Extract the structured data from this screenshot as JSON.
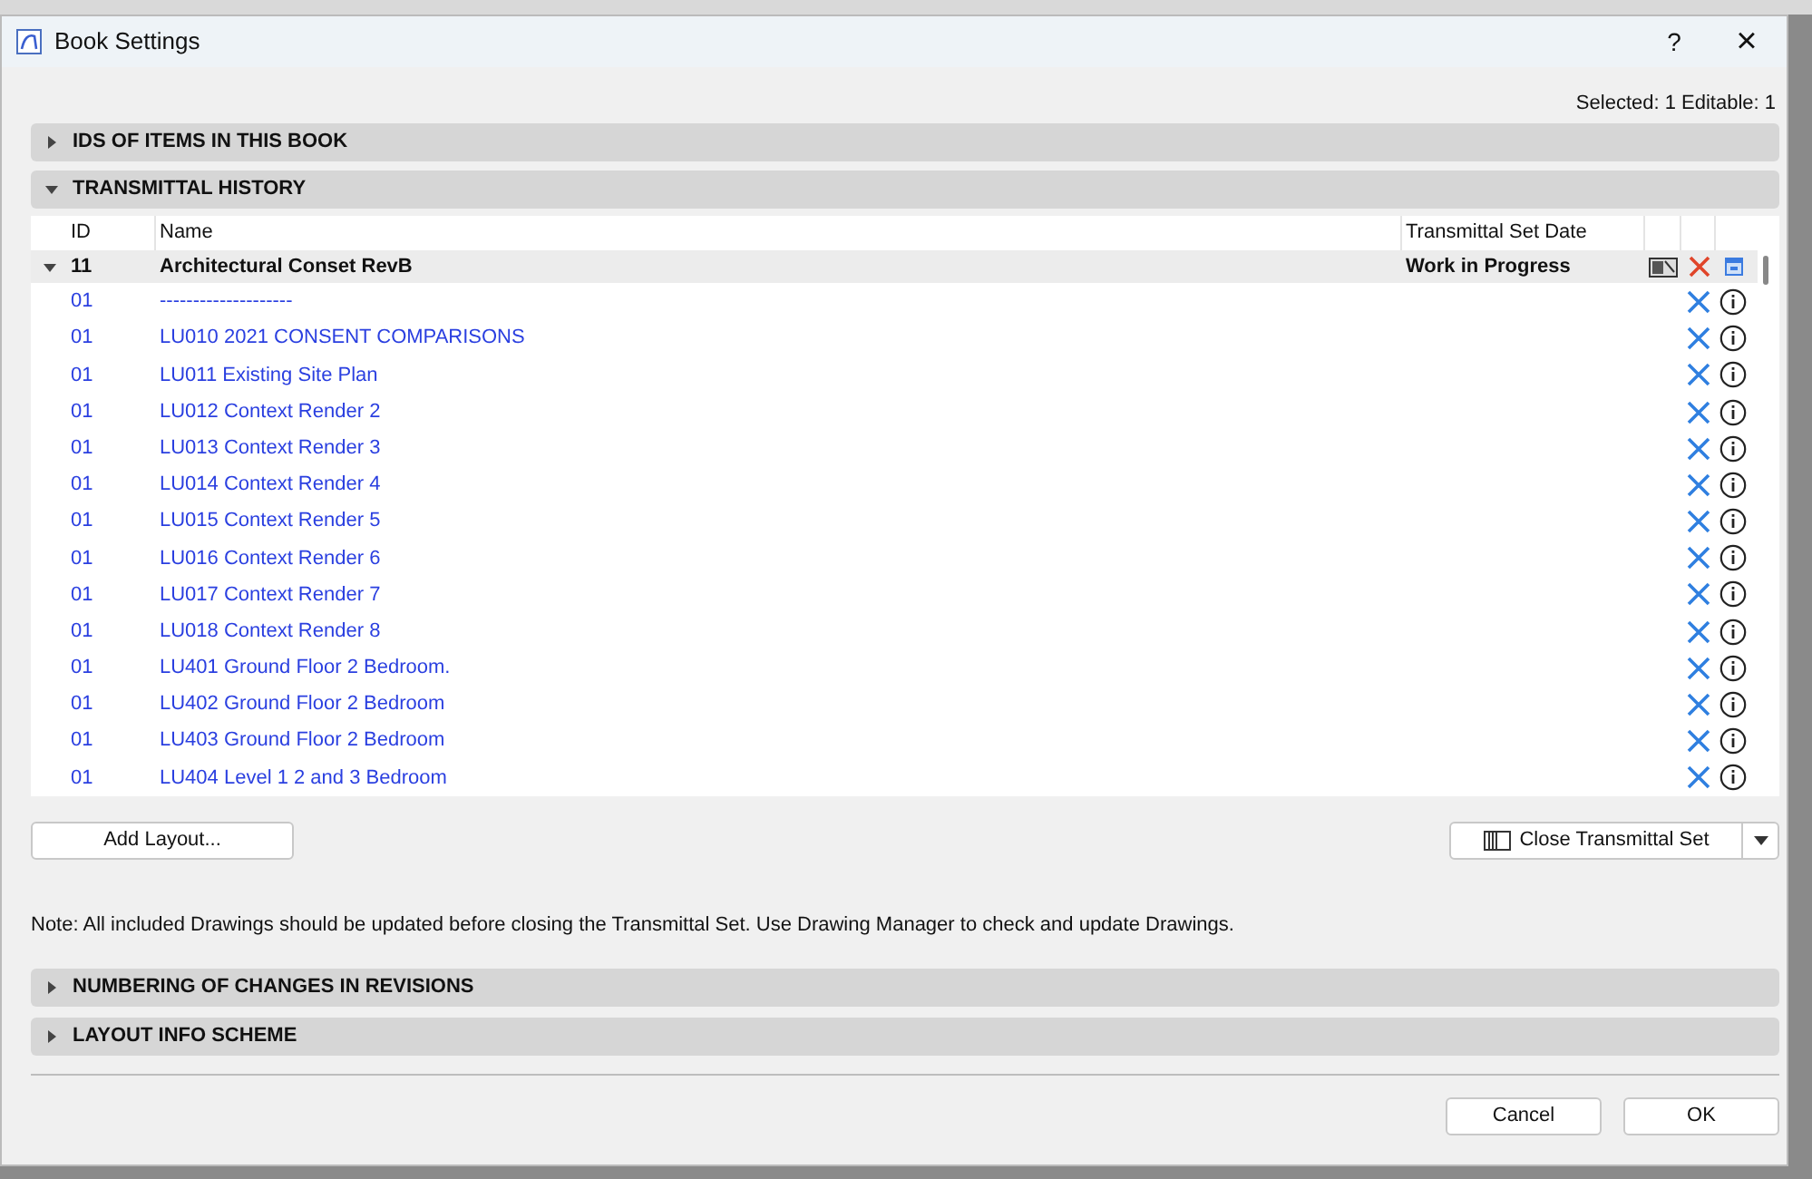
{
  "window": {
    "title": "Book Settings",
    "help": "?",
    "close": "×"
  },
  "selection_info": "Selected: 1 Editable: 1",
  "sections_top": [
    {
      "label": "IDS OF ITEMS IN THIS BOOK",
      "expanded": false
    },
    {
      "label": "TRANSMITTAL HISTORY",
      "expanded": true
    }
  ],
  "table": {
    "columns": [
      "ID",
      "Name",
      "Transmittal Set Date"
    ],
    "group": {
      "id": "11",
      "name": "Architectural Conset RevB",
      "date": "Work in Progress",
      "expanded": true
    },
    "rows": [
      {
        "id": "01",
        "name": "--------------------"
      },
      {
        "id": "01",
        "name": "LU010 2021 CONSENT COMPARISONS"
      },
      {
        "id": "01",
        "name": "LU011 Existing Site Plan"
      },
      {
        "id": "01",
        "name": "LU012 Context Render 2"
      },
      {
        "id": "01",
        "name": "LU013 Context Render 3"
      },
      {
        "id": "01",
        "name": "LU014 Context Render 4"
      },
      {
        "id": "01",
        "name": "LU015 Context Render 5"
      },
      {
        "id": "01",
        "name": "LU016 Context Render 6"
      },
      {
        "id": "01",
        "name": "LU017 Context Render 7"
      },
      {
        "id": "01",
        "name": "LU018 Context Render 8"
      },
      {
        "id": "01",
        "name": "LU401 Ground Floor 2 Bedroom."
      },
      {
        "id": "01",
        "name": "LU402 Ground Floor 2 Bedroom"
      },
      {
        "id": "01",
        "name": "LU403 Ground Floor 2 Bedroom"
      },
      {
        "id": "01",
        "name": "LU404 Level 1 2 and 3 Bedroom"
      }
    ]
  },
  "add_layout_button": "Add Layout...",
  "close_transmittal_button": "Close Transmittal Set",
  "note": "Note: All included Drawings should be updated before closing the Transmittal Set. Use Drawing Manager to check and update Drawings.",
  "sections_bottom": [
    {
      "label": "NUMBERING OF CHANGES IN REVISIONS",
      "expanded": false
    },
    {
      "label": "LAYOUT INFO SCHEME",
      "expanded": false
    }
  ],
  "buttons": [
    "Cancel",
    "OK"
  ]
}
